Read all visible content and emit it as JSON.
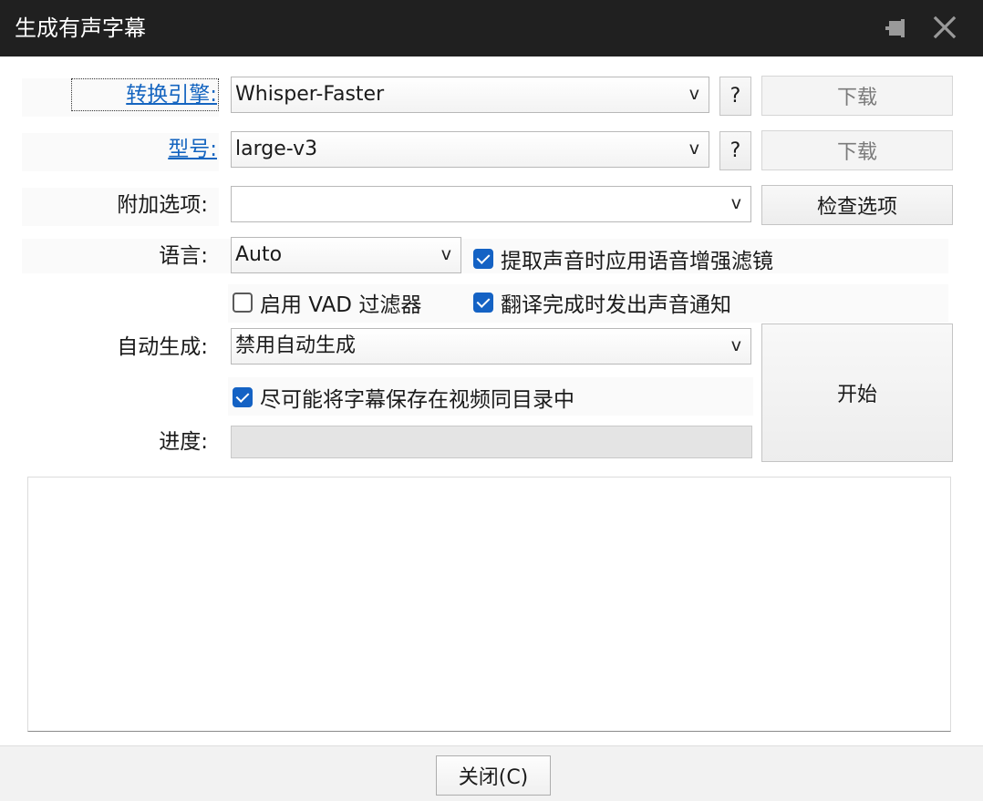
{
  "window": {
    "title": "生成有声字幕",
    "pin_icon": "pin-icon",
    "close_icon": "close-icon"
  },
  "form": {
    "engine": {
      "label": "转换引擎:",
      "value": "Whisper-Faster",
      "help_label": "?",
      "download_label": "下载"
    },
    "model": {
      "label": "型号:",
      "value": "large-v3",
      "help_label": "?",
      "download_label": "下载"
    },
    "extra_options": {
      "label": "附加选项:",
      "value": "",
      "check_label": "检查选项"
    },
    "language": {
      "label": "语言:",
      "value": "Auto"
    },
    "enhance_filter": {
      "label": "提取声音时应用语音增强滤镜",
      "checked": true
    },
    "vad_filter": {
      "label": "启用 VAD 过滤器",
      "checked": false
    },
    "notify_sound": {
      "label": "翻译完成时发出声音通知",
      "checked": true
    },
    "auto_generate": {
      "label": "自动生成:",
      "value": "禁用自动生成"
    },
    "save_with_video": {
      "label": "尽可能将字幕保存在视频同目录中",
      "checked": true
    },
    "progress": {
      "label": "进度:",
      "value": 0
    },
    "start_label": "开始",
    "dropdown_chevron": "v"
  },
  "footer": {
    "close_label": "关闭(C)"
  },
  "colors": {
    "titlebar": "#202020",
    "accent": "#1462c4",
    "link": "#1565c0"
  }
}
